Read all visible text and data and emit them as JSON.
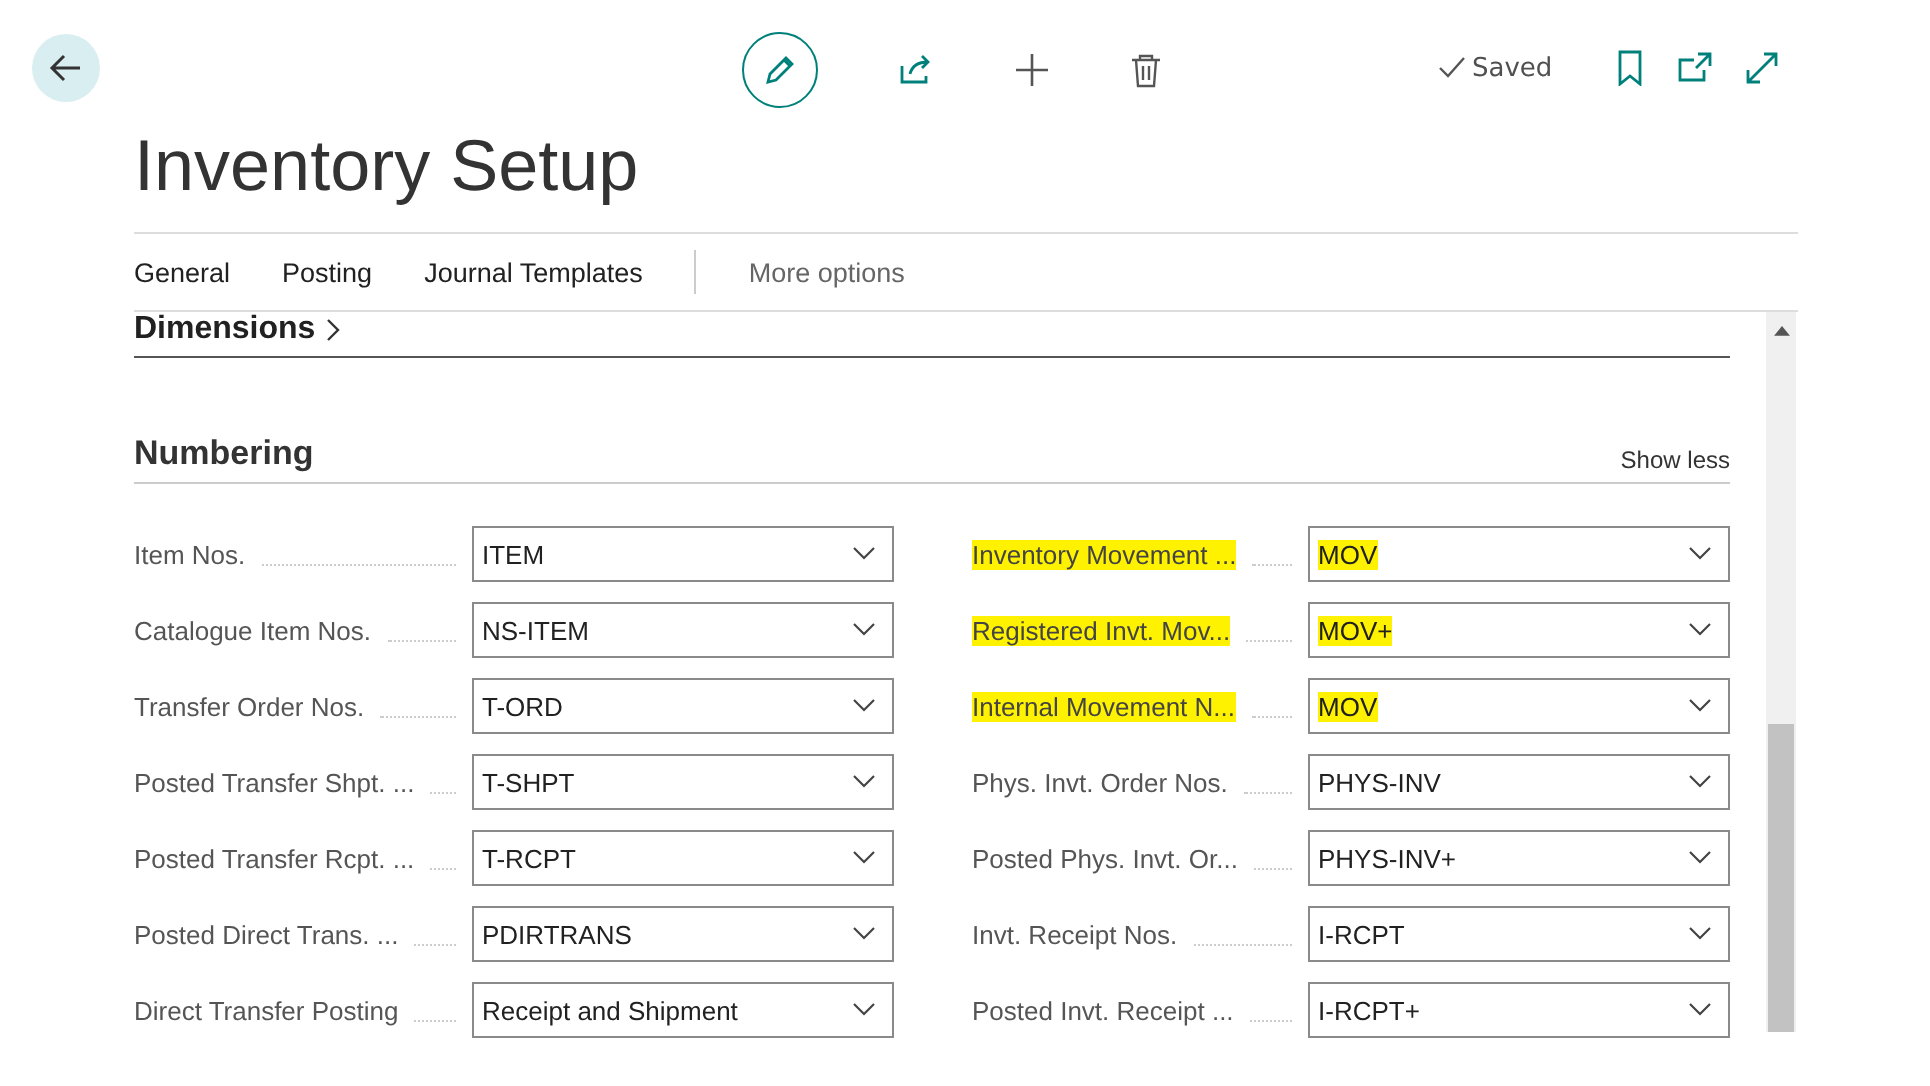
{
  "toolbar": {
    "status": "Saved"
  },
  "page": {
    "title": "Inventory Setup"
  },
  "tabs": [
    {
      "label": "General"
    },
    {
      "label": "Posting"
    },
    {
      "label": "Journal Templates"
    },
    {
      "label": "More options",
      "kind": "more"
    }
  ],
  "sections": {
    "collapsed_title": "Dimensions",
    "title": "Numbering",
    "toggle": "Show less"
  },
  "left_fields": [
    {
      "label": "Item Nos.",
      "value": "ITEM",
      "highlighted": false
    },
    {
      "label": "Catalogue Item Nos.",
      "value": "NS-ITEM",
      "highlighted": false
    },
    {
      "label": "Transfer Order Nos.",
      "value": "T-ORD",
      "highlighted": false
    },
    {
      "label": "Posted Transfer Shpt. ...",
      "value": "T-SHPT",
      "highlighted": false
    },
    {
      "label": "Posted Transfer Rcpt. ...",
      "value": "T-RCPT",
      "highlighted": false
    },
    {
      "label": "Posted Direct Trans. ...",
      "value": "PDIRTRANS",
      "highlighted": false
    },
    {
      "label": "Direct Transfer Posting",
      "value": "Receipt and Shipment",
      "highlighted": false
    }
  ],
  "right_fields": [
    {
      "label": "Inventory Movement ...",
      "value": "MOV",
      "highlighted": true
    },
    {
      "label": "Registered Invt. Mov...",
      "value": "MOV+",
      "highlighted": true
    },
    {
      "label": "Internal Movement N...",
      "value": "MOV",
      "highlighted": true
    },
    {
      "label": "Phys. Invt. Order Nos.",
      "value": "PHYS-INV",
      "highlighted": false
    },
    {
      "label": "Posted Phys. Invt. Or...",
      "value": "PHYS-INV+",
      "highlighted": false
    },
    {
      "label": "Invt. Receipt Nos.",
      "value": "I-RCPT",
      "highlighted": false
    },
    {
      "label": "Posted Invt. Receipt ...",
      "value": "I-RCPT+",
      "highlighted": false
    }
  ]
}
